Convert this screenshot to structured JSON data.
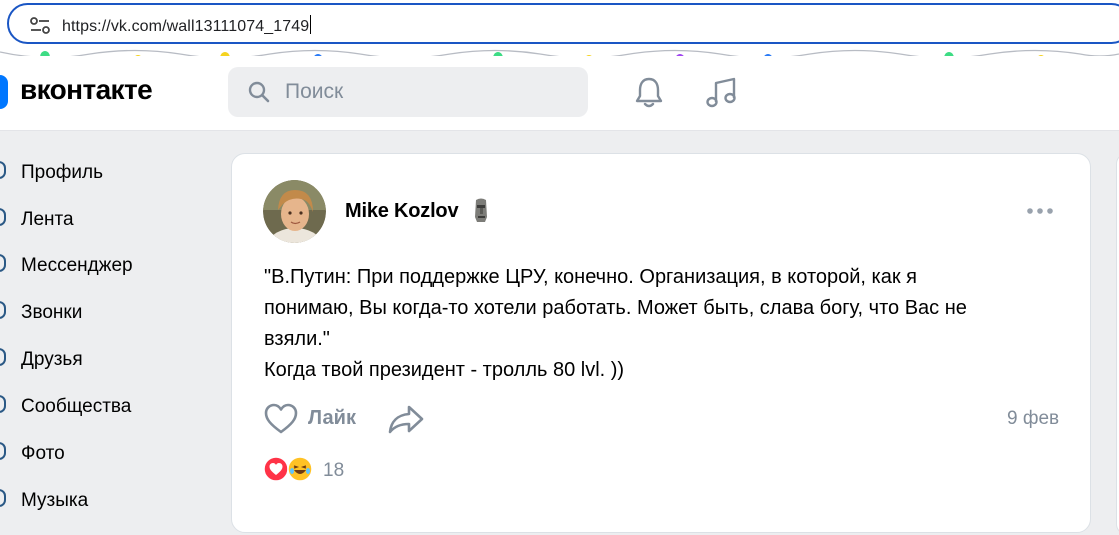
{
  "browser": {
    "url": "https://vk.com/wall13111074_1749"
  },
  "header": {
    "logo_text": "вконтакте",
    "search_placeholder": "Поиск",
    "icons": [
      "bell-icon",
      "music-icon"
    ],
    "brand_color": "#0077ff"
  },
  "sidebar": {
    "items": [
      {
        "label": "Профиль"
      },
      {
        "label": "Лента"
      },
      {
        "label": "Мессенджер"
      },
      {
        "label": "Звонки"
      },
      {
        "label": "Друзья"
      },
      {
        "label": "Сообщества"
      },
      {
        "label": "Фото"
      },
      {
        "label": "Музыка"
      }
    ]
  },
  "post": {
    "author": "Mike Kozlov",
    "author_emoji": "moai-icon",
    "text_lines": [
      "\"В.Путин: При поддержке ЦРУ, конечно. Организация, в которой, как я",
      "понимаю, Вы когда-то хотели работать. Может быть, слава богу, что Вас не",
      "взяли.\"",
      "Когда твой президент - тролль 80 lvl. ))"
    ],
    "like_label": "Лайк",
    "date": "9 фев",
    "reactions_count": "18",
    "reaction_icons": [
      "heart-reaction-icon",
      "laugh-reaction-icon"
    ]
  }
}
